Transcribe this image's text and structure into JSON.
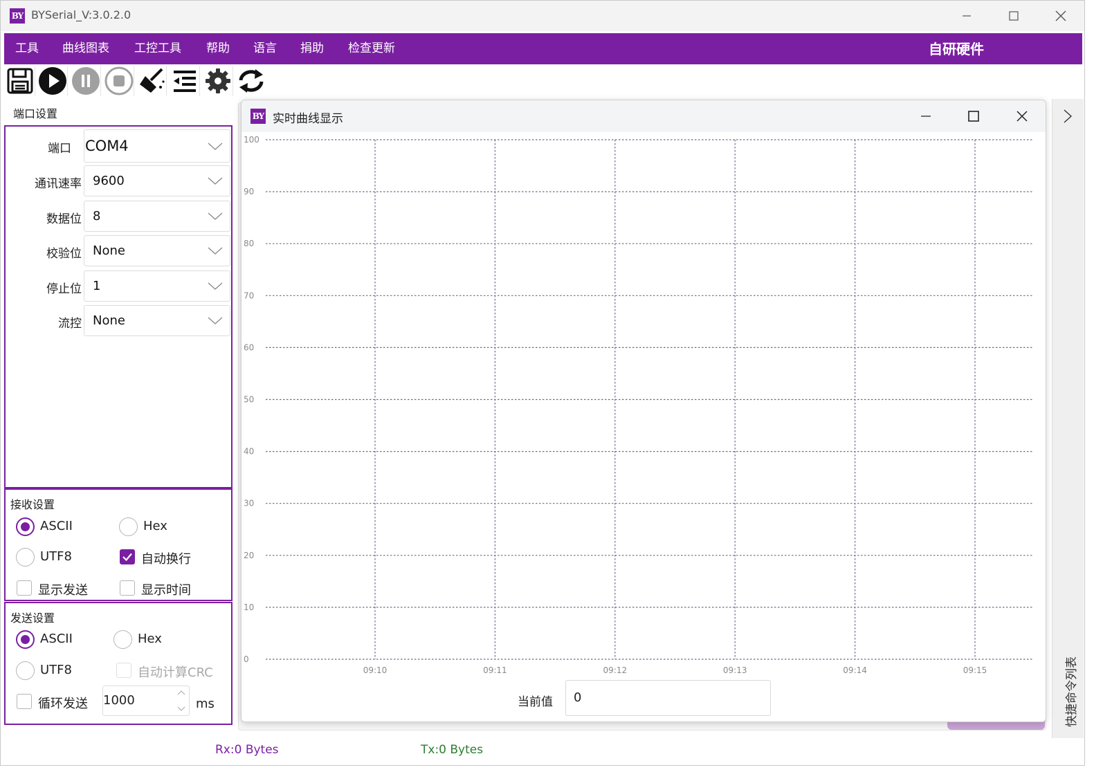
{
  "window": {
    "title": "BYSerial_V:3.0.2.0",
    "logo_text": "BY"
  },
  "menu": {
    "items": [
      "工具",
      "曲线图表",
      "工控工具",
      "帮助",
      "语言",
      "捐助",
      "检查更新"
    ],
    "brand": "自研硬件"
  },
  "toolbar": {
    "icons": [
      "save-icon",
      "play-icon",
      "pause-icon",
      "stop-icon",
      "clear-icon",
      "indent-icon",
      "gear-icon",
      "refresh-icon"
    ]
  },
  "port_settings": {
    "title": "端口设置",
    "fields": [
      {
        "label": "端口",
        "value": "COM4"
      },
      {
        "label": "通讯速率",
        "value": "9600"
      },
      {
        "label": "数据位",
        "value": "8"
      },
      {
        "label": "校验位",
        "value": "None"
      },
      {
        "label": "停止位",
        "value": "1"
      },
      {
        "label": "流控",
        "value": "None"
      }
    ]
  },
  "receive_settings": {
    "title": "接收设置",
    "ascii": "ASCII",
    "hex": "Hex",
    "utf8": "UTF8",
    "auto_wrap": "自动换行",
    "show_send": "显示发送",
    "show_time": "显示时间",
    "selected": "ASCII",
    "auto_wrap_checked": true,
    "show_send_checked": false,
    "show_time_checked": false
  },
  "send_settings": {
    "title": "发送设置",
    "ascii": "ASCII",
    "hex": "Hex",
    "utf8": "UTF8",
    "auto_crc": "自动计算CRC",
    "loop_send": "循环发送",
    "interval": "1000",
    "unit": "ms",
    "selected": "ASCII"
  },
  "status": {
    "rx": "Rx:0 Bytes",
    "tx": "Tx:0 Bytes",
    "rx_color": "#7b1fa2",
    "tx_color": "#2e7d32"
  },
  "side_panel": {
    "label": "快捷命令列表"
  },
  "chart_window": {
    "title": "实时曲线显示",
    "current_label": "当前值",
    "current_value": "0"
  },
  "colors": {
    "accent": "#7b1fa2",
    "grid": "#6b6b8a"
  },
  "chart_data": {
    "type": "line",
    "series": [],
    "y_ticks": [
      "0",
      "10",
      "20",
      "30",
      "40",
      "50",
      "60",
      "70",
      "80",
      "90",
      "100"
    ],
    "x_ticks": [
      "09:10",
      "09:11",
      "09:12",
      "09:13",
      "09:14",
      "09:15"
    ],
    "ylim": [
      0,
      100
    ],
    "grid": true,
    "grid_style": "dotted"
  }
}
